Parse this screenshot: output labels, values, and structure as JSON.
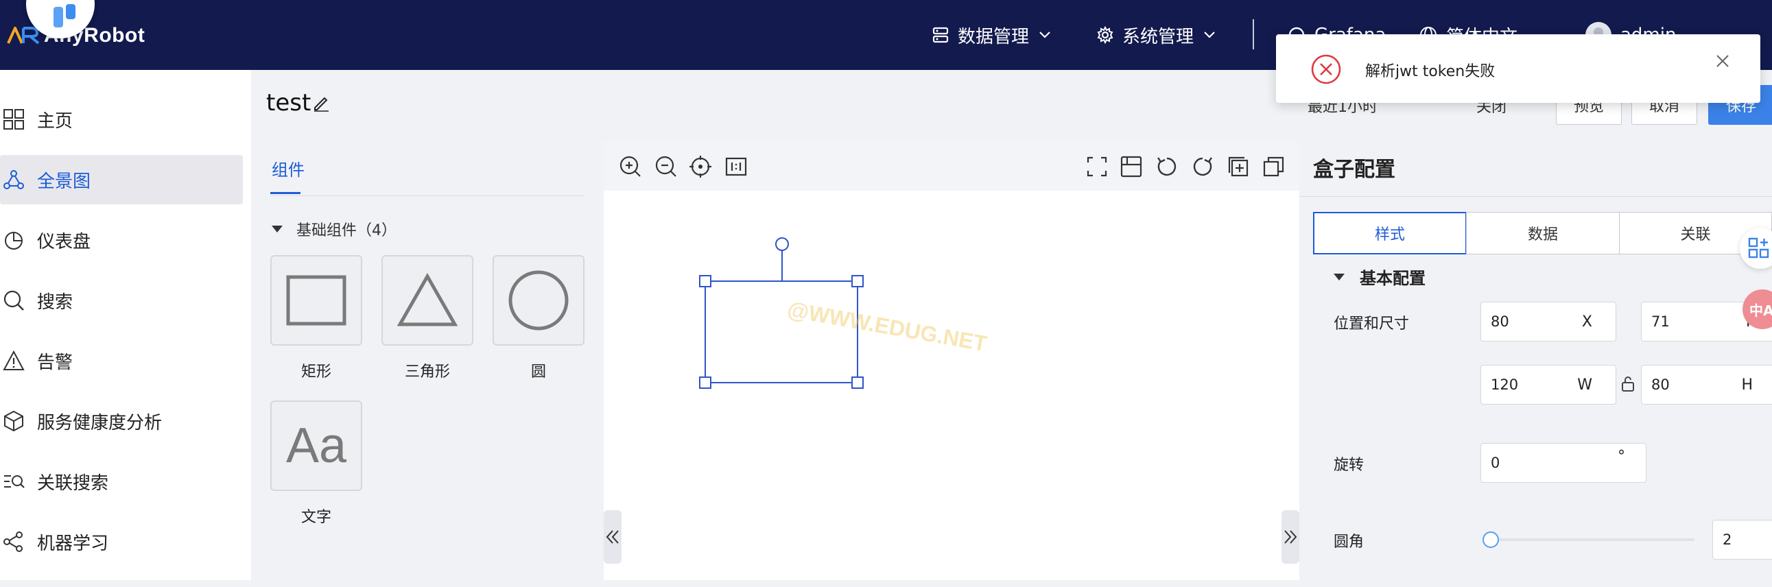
{
  "header": {
    "brand": "AnyRobot",
    "nav": [
      {
        "label": "数据管理",
        "icon": "data-management-icon"
      },
      {
        "label": "系统管理",
        "icon": "gear-icon"
      },
      {
        "label": "Grafana",
        "icon": "grafana-icon"
      },
      {
        "label": "简体中文",
        "icon": "globe-icon"
      },
      {
        "label": "admin",
        "icon": "avatar-icon"
      }
    ]
  },
  "sidebar": {
    "items": [
      {
        "label": "主页",
        "icon": "grid-icon"
      },
      {
        "label": "全景图",
        "icon": "topology-icon",
        "active": true
      },
      {
        "label": "仪表盘",
        "icon": "pie-chart-icon"
      },
      {
        "label": "搜索",
        "icon": "search-icon"
      },
      {
        "label": "告警",
        "icon": "warning-icon"
      },
      {
        "label": "服务健康度分析",
        "icon": "cube-icon"
      },
      {
        "label": "关联搜索",
        "icon": "list-search-icon"
      },
      {
        "label": "机器学习",
        "icon": "network-icon"
      }
    ]
  },
  "page": {
    "title": "test"
  },
  "top_actions": {
    "recent": "最近1小时",
    "refresh": "关闭",
    "preview": "预览",
    "cancel": "取消",
    "save": "保存"
  },
  "components": {
    "tab": "组件",
    "group_title": "基础组件（4）",
    "items": [
      {
        "label": "矩形",
        "icon": "rectangle-icon"
      },
      {
        "label": "三角形",
        "icon": "triangle-icon"
      },
      {
        "label": "圆",
        "icon": "circle-icon"
      },
      {
        "label": "文字",
        "icon": "text-icon",
        "glyph": "Aa"
      }
    ]
  },
  "canvas": {
    "watermark": "@WWW.EDUG.NET"
  },
  "config": {
    "title": "盒子配置",
    "tabs": [
      "样式",
      "数据",
      "关联"
    ],
    "active_tab": "样式",
    "section": "基本配置",
    "position_label": "位置和尺寸",
    "x": {
      "value": "80",
      "suffix": "X"
    },
    "y": {
      "value": "71",
      "suffix": "Y"
    },
    "w": {
      "value": "120",
      "suffix": "W"
    },
    "h": {
      "value": "80",
      "suffix": "H"
    },
    "rotate_label": "旋转",
    "rotate": {
      "value": "0",
      "suffix": "°"
    },
    "radius_label": "圆角",
    "radius_value": "2",
    "radius_slider_level": 0
  },
  "toast": {
    "type": "error",
    "message": "解析jwt token失败"
  },
  "floating": {
    "lang": "中A"
  },
  "colors": {
    "header_bg": "#121a4e",
    "accent": "#1d5bd8",
    "error": "#e0393e"
  }
}
